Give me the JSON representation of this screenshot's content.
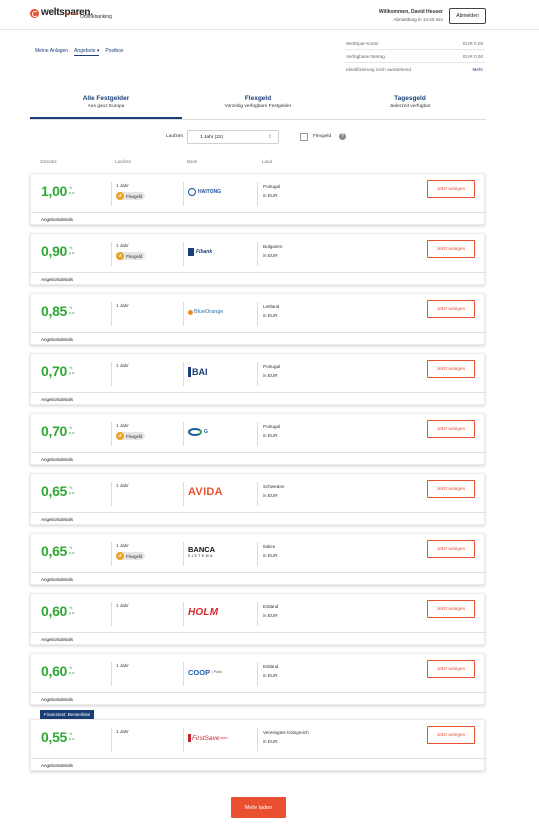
{
  "header": {
    "logo_text": "weltsparen.",
    "logo_sub": "by raisin",
    "online_banking": "Onlinebanking",
    "welcome": "Willkommen, David Heuser",
    "logout_timer": "Abmeldung in 14:43 min",
    "logout_button": "Abmelden"
  },
  "nav": {
    "items": [
      "Meine Anlagen",
      "Angebote ▾",
      "Postbox"
    ]
  },
  "account": {
    "rows": [
      {
        "label": "WeltSpar-Konto",
        "value": "EUR 0,00"
      },
      {
        "label": "Verfügbarer Betrag",
        "value": "EUR 0,00"
      },
      {
        "label": "Identifizierung noch ausstehend",
        "value": "Mehr"
      }
    ]
  },
  "tabs": [
    {
      "title": "Alle Festgelder",
      "sub": "Aus ganz Europa"
    },
    {
      "title": "Flexgeld",
      "sub": "Vorzeitig verfügbare Festgelder"
    },
    {
      "title": "Tagesgeld",
      "sub": "Jederzeit verfügbar"
    }
  ],
  "filter": {
    "label": "Laufzeit",
    "selected": "1 Jahr (22)",
    "checkbox_label": "Flexgeld",
    "help_icon": "?"
  },
  "columns": [
    "Zinssatz",
    "Laufzeit",
    "Bank",
    "Land"
  ],
  "offers": [
    {
      "rate": "1,00",
      "term": "1 Jahr",
      "flex": true,
      "bank_logo": "HAITONG",
      "bank_sub": "",
      "country": "Portugal",
      "currency": "in EUR"
    },
    {
      "rate": "0,90",
      "term": "1 Jahr",
      "flex": true,
      "bank_logo": "Fibank",
      "bank_sub": "",
      "country": "Bulgarien",
      "currency": "in EUR"
    },
    {
      "rate": "0,85",
      "term": "1 Jahr",
      "flex": false,
      "bank_logo": "BlueOrange",
      "bank_sub": "",
      "country": "Lettland",
      "currency": "in EUR"
    },
    {
      "rate": "0,70",
      "term": "1 Jahr",
      "flex": false,
      "bank_logo": "BAI",
      "bank_sub": "",
      "country": "Portugal",
      "currency": "in EUR"
    },
    {
      "rate": "0,70",
      "term": "1 Jahr",
      "flex": true,
      "bank_logo": "G",
      "bank_sub": "",
      "country": "Portugal",
      "currency": "in EUR"
    },
    {
      "rate": "0,65",
      "term": "1 Jahr",
      "flex": false,
      "bank_logo": "AVIDA",
      "bank_sub": "",
      "country": "Schweden",
      "currency": "in EUR"
    },
    {
      "rate": "0,65",
      "term": "1 Jahr",
      "flex": true,
      "bank_logo": "BANCA",
      "bank_sub": "SISTEMA",
      "country": "Italien",
      "currency": "in EUR"
    },
    {
      "rate": "0,60",
      "term": "1 Jahr",
      "flex": false,
      "bank_logo": "HOLM",
      "bank_sub": "",
      "country": "Estland",
      "currency": "in EUR"
    },
    {
      "rate": "0,60",
      "term": "1 Jahr",
      "flex": false,
      "bank_logo": "COOP",
      "bank_sub": "| Pank",
      "country": "Estland",
      "currency": "in EUR"
    },
    {
      "rate": "0,55",
      "term": "1 Jahr",
      "flex": false,
      "bank_logo": "FirstSave",
      "bank_sub": "euro",
      "country": "Vereinigtes Königreich",
      "currency": "in EUR"
    }
  ],
  "offer_common": {
    "unit_pct": "%",
    "unit_pa": "p.a.",
    "flex_label": "Flexgeld",
    "button": "Jetzt anlegen",
    "details": "Angebotsdetails"
  },
  "promo_badge": "Finanztest: Bestenliste",
  "more_button": "Mehr laden",
  "colors": {
    "accent": "#e8502f",
    "rate_green": "#2fa836",
    "nav_blue": "#1a3f78"
  }
}
